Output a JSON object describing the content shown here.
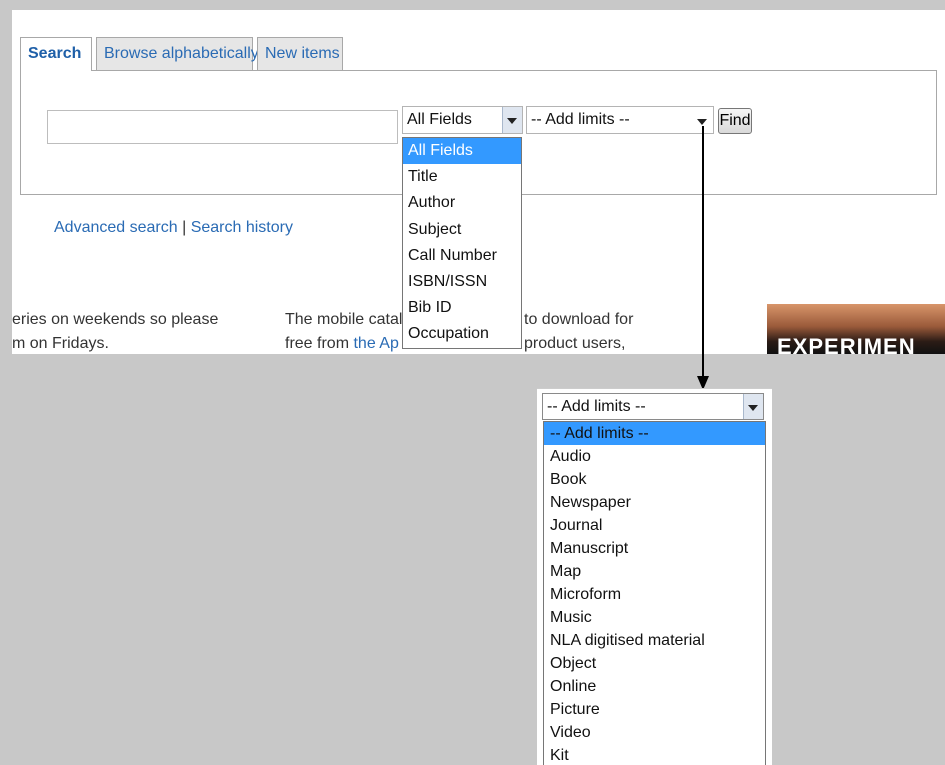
{
  "tabs": [
    {
      "label": "Search"
    },
    {
      "label": "Browse alphabetically"
    },
    {
      "label": "New items"
    }
  ],
  "search": {
    "query_value": "",
    "field_select": {
      "selected": "All Fields"
    },
    "limit_select": {
      "selected": "-- Add limits --"
    },
    "find_label": "Find"
  },
  "links": {
    "advanced": "Advanced search",
    "separator": " | ",
    "history": "Search history"
  },
  "field_options": [
    "All Fields",
    "Title",
    "Author",
    "Subject",
    "Call Number",
    "ISBN/ISSN",
    "Bib ID",
    "Occupation"
  ],
  "background_text": {
    "col1_line1": "eries on weekends so please",
    "col1_line2": "m on Fridays.",
    "col2_line1": "The mobile catal",
    "col2_line2_prefix": "free from ",
    "col2_line2_link": "the Ap",
    "col3_line1": "to download for",
    "col3_line2": "product users,",
    "banner": "EXPERIMEN"
  },
  "limit_options": [
    "-- Add limits --",
    "Audio",
    "Book",
    "Newspaper",
    "Journal",
    "Manuscript",
    "Map",
    "Microform",
    "Music",
    "NLA digitised material",
    "Object",
    "Online",
    "Picture",
    "Video",
    "Kit"
  ],
  "colors": {
    "link": "#2a6bb4",
    "highlight": "#3399ff",
    "backdrop": "#c8c8c8"
  }
}
